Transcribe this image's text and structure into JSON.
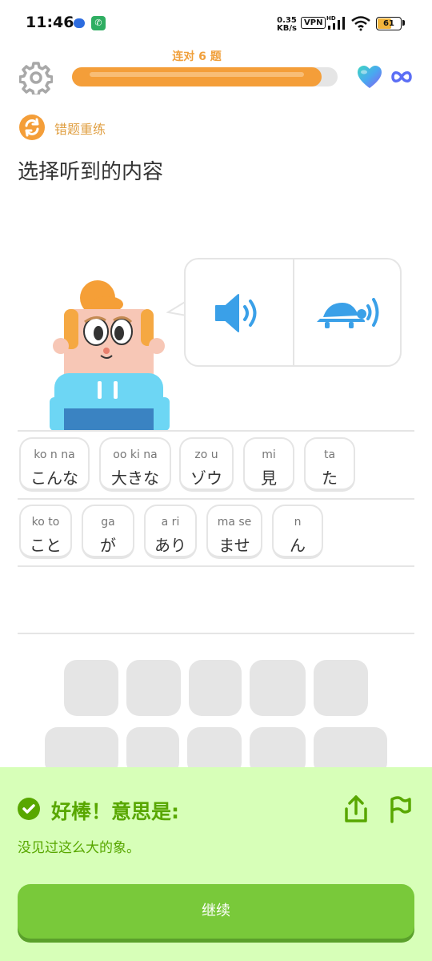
{
  "status_bar": {
    "time": "11:46",
    "speed_value": "0.35",
    "speed_unit": "KB/s",
    "vpn": "VPN",
    "battery": "61",
    "icons": [
      "message-icon",
      "phone-icon",
      "signal-icon",
      "wifi-icon",
      "battery-icon"
    ]
  },
  "header": {
    "streak_label": "连对 6 题",
    "progress_fraction": 0.94,
    "icons": [
      "gear-icon",
      "heart-icon",
      "infinity-icon"
    ]
  },
  "review": {
    "label": "错题重练"
  },
  "prompt": {
    "title": "选择听到的内容"
  },
  "audio": {
    "icons": [
      "speaker-icon",
      "turtle-slow-icon"
    ]
  },
  "answer_tiles": [
    {
      "ruby": "ko n na",
      "word": "こんな"
    },
    {
      "ruby": "oo ki na",
      "word": "大きな"
    },
    {
      "ruby": "zo u",
      "word": "ゾウ"
    },
    {
      "ruby": "mi",
      "word": "見"
    },
    {
      "ruby": "ta",
      "word": "た"
    },
    {
      "ruby": "ko to",
      "word": "こと"
    },
    {
      "ruby": "ga",
      "word": "が"
    },
    {
      "ruby": "a ri",
      "word": "あり"
    },
    {
      "ruby": "ma se",
      "word": "ませ"
    },
    {
      "ruby": "n",
      "word": "ん"
    }
  ],
  "feedback": {
    "title": "好棒！意思是:",
    "meaning": "没见过这么大的象。",
    "continue_label": "继续",
    "icons": [
      "check-icon",
      "share-icon",
      "flag-icon"
    ]
  },
  "colors": {
    "orange": "#f49e39",
    "green": "#58a700",
    "button_green": "#79c93a",
    "panel_bg": "#d7ffb8",
    "blue": "#3aa0e8"
  }
}
